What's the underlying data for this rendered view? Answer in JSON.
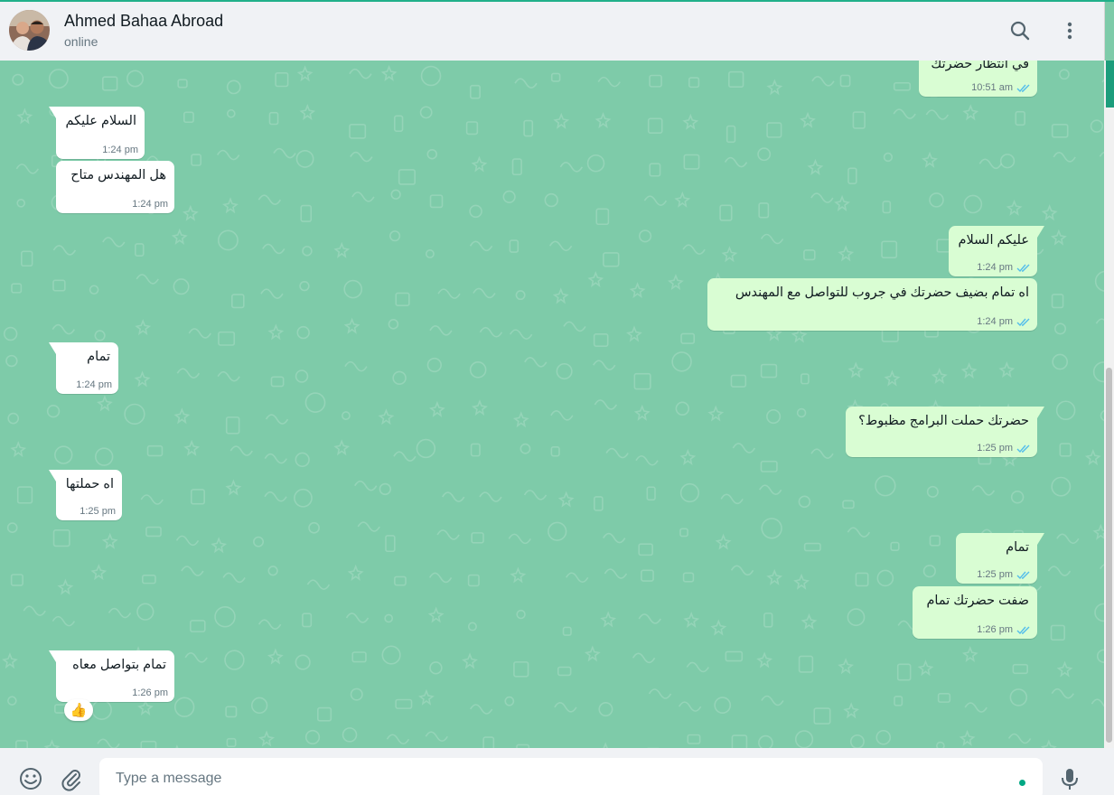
{
  "header": {
    "contact_name": "Ahmed Bahaa Abroad",
    "contact_status": "online"
  },
  "messages": [
    {
      "direction": "out",
      "text": "في انتظار حضرتك",
      "time": "10:51 am",
      "read": true
    },
    {
      "direction": "in",
      "text": "السلام عليكم",
      "time": "1:24 pm"
    },
    {
      "direction": "in",
      "text": "هل المهندس متاح",
      "time": "1:24 pm"
    },
    {
      "direction": "out",
      "text": "عليكم السلام",
      "time": "1:24 pm",
      "read": true
    },
    {
      "direction": "out",
      "text": "اه تمام بضيف حضرتك في جروب للتواصل مع المهندس",
      "time": "1:24 pm",
      "read": true
    },
    {
      "direction": "in",
      "text": "تمام",
      "time": "1:24 pm"
    },
    {
      "direction": "out",
      "text": "حضرتك حملت البرامج مظبوط؟",
      "time": "1:25 pm",
      "read": true
    },
    {
      "direction": "in",
      "text": "اه حملتها",
      "time": "1:25 pm"
    },
    {
      "direction": "out",
      "text": "تمام",
      "time": "1:25 pm",
      "read": true
    },
    {
      "direction": "out",
      "text": "ضفت حضرتك تمام",
      "time": "1:26 pm",
      "read": true
    },
    {
      "direction": "in",
      "text": "تمام بتواصل معاه",
      "time": "1:26 pm",
      "reaction": "👍"
    }
  ],
  "composer": {
    "placeholder": "Type a message",
    "value": ""
  },
  "icons": {
    "search": "search-icon",
    "menu": "menu-icon",
    "emoji": "emoji-icon",
    "attach": "attach-icon",
    "mic": "mic-icon",
    "read_receipt": "double-check-icon"
  },
  "colors": {
    "chat_background": "#7ecba9",
    "incoming_bubble": "#ffffff",
    "outgoing_bubble": "#d9fdd3",
    "read_tick": "#53bdeb",
    "accent": "#00a884"
  }
}
